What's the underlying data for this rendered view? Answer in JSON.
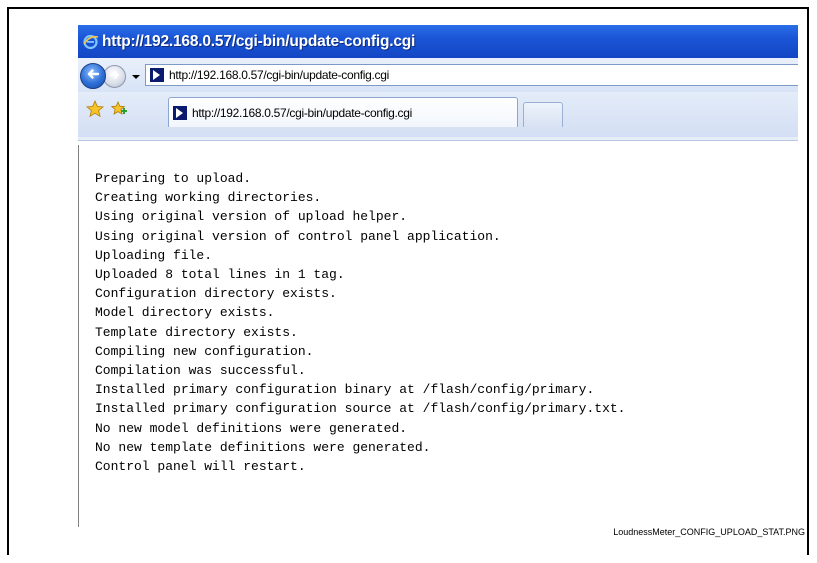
{
  "window": {
    "title": "http://192.168.0.57/cgi-bin/update-config.cgi",
    "title_icon": "ie-icon"
  },
  "navigation": {
    "back_icon": "back-arrow-icon",
    "forward_icon": "forward-arrow-icon",
    "history_dropdown_icon": "chevron-down-icon",
    "address_value": "http://192.168.0.57/cgi-bin/update-config.cgi",
    "address_icon": "page-icon"
  },
  "tabs": {
    "favorites_icon": "star-icon",
    "add_favorites_icon": "add-favorites-icon",
    "active_tab_label": "http://192.168.0.57/cgi-bin/update-config.cgi",
    "new_tab_icon": "new-tab-icon"
  },
  "output": {
    "lines": [
      "Preparing to upload.",
      "Creating working directories.",
      "Using original version of upload helper.",
      "Using original version of control panel application.",
      "Uploading file.",
      "Uploaded 8 total lines in 1 tag.",
      "Configuration directory exists.",
      "Model directory exists.",
      "Template directory exists.",
      "Compiling new configuration.",
      "Compilation was successful.",
      "Installed primary configuration binary at /flash/config/primary.",
      "Installed primary configuration source at /flash/config/primary.txt.",
      "No new model definitions were generated.",
      "No new template definitions were generated.",
      "Control panel will restart."
    ]
  },
  "caption": "LoudnessMeter_CONFIG_UPLOAD_STAT.PNG",
  "colors": {
    "title_bar": "#1a55d6",
    "nav_bar": "#d7e3f6",
    "frame_border": "#000000"
  }
}
